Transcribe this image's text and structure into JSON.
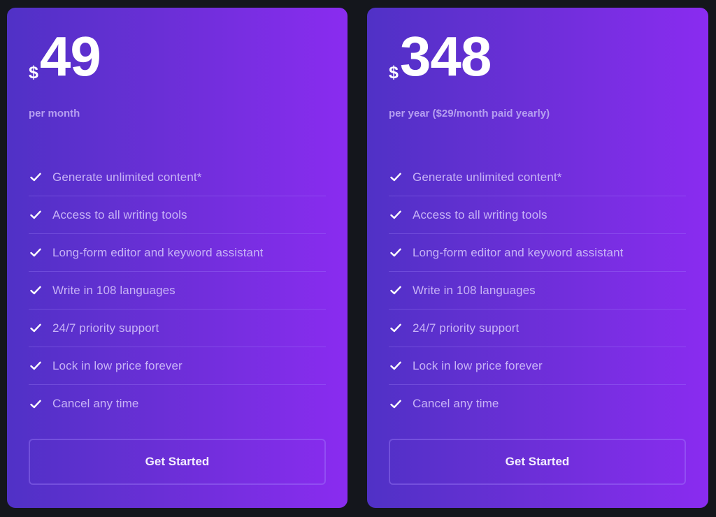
{
  "plans": [
    {
      "currency_symbol": "$",
      "price": "49",
      "period": "per month",
      "features": [
        {
          "icon": "check-icon",
          "label": "Generate unlimited content*"
        },
        {
          "icon": "check-icon",
          "label": "Access to all writing tools"
        },
        {
          "icon": "check-icon",
          "label": "Long-form editor and keyword assistant"
        },
        {
          "icon": "check-icon",
          "label": "Write in 108 languages"
        },
        {
          "icon": "check-icon",
          "label": "24/7 priority support"
        },
        {
          "icon": "check-icon",
          "label": "Lock in low price forever"
        },
        {
          "icon": "check-icon",
          "label": "Cancel any time"
        }
      ],
      "cta_label": "Get Started"
    },
    {
      "currency_symbol": "$",
      "price": "348",
      "period": "per year ($29/month paid yearly)",
      "features": [
        {
          "icon": "check-icon",
          "label": "Generate unlimited content*"
        },
        {
          "icon": "check-icon",
          "label": "Access to all writing tools"
        },
        {
          "icon": "check-icon",
          "label": "Long-form editor and keyword assistant"
        },
        {
          "icon": "check-icon",
          "label": "Write in 108 languages"
        },
        {
          "icon": "check-icon",
          "label": "24/7 priority support"
        },
        {
          "icon": "check-icon",
          "label": "Lock in low price forever"
        },
        {
          "icon": "check-icon",
          "label": "Cancel any time"
        }
      ],
      "cta_label": "Get Started"
    }
  ],
  "colors": {
    "background": "#14161c",
    "card_gradient_start": "#5031c6",
    "card_gradient_end": "#8a2cf0",
    "price_text": "#ffffff",
    "muted_text": "#b59ef0",
    "feature_text": "#c7b3f6"
  }
}
